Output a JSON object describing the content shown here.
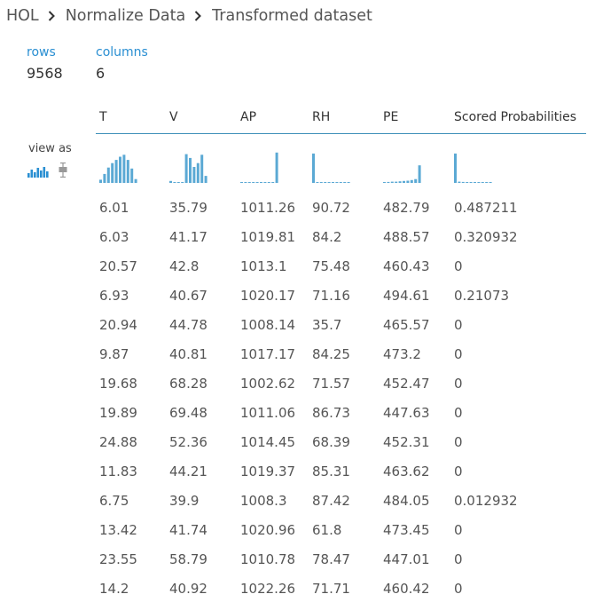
{
  "breadcrumb": {
    "items": [
      "HOL",
      "Normalize Data",
      "Transformed dataset"
    ],
    "separator_icon": "chevron-right-icon"
  },
  "summary": {
    "rows_label": "rows",
    "rows_value": "9568",
    "columns_label": "columns",
    "columns_value": "6"
  },
  "view_as": {
    "label": "view as",
    "options": [
      "histogram-icon",
      "boxplot-icon"
    ],
    "selected": "histogram-icon"
  },
  "colors": {
    "accent": "#2a8fd2",
    "histogram_bar": "#5ba9d4",
    "header_rule": "#3d8fb8",
    "text": "#555555"
  },
  "table": {
    "columns": [
      "T",
      "V",
      "AP",
      "RH",
      "PE",
      "Scored Probabilities"
    ],
    "histograms": [
      [
        0.1,
        0.28,
        0.48,
        0.62,
        0.72,
        0.82,
        0.88,
        0.72,
        0.45,
        0.12
      ],
      [
        0.06,
        0,
        0,
        0,
        0.9,
        0.78,
        0.5,
        0.62,
        0.88,
        0.22
      ],
      [
        0,
        0,
        0,
        0,
        0,
        0,
        0,
        0,
        0,
        0.95
      ],
      [
        0.92,
        0,
        0,
        0,
        0,
        0,
        0,
        0,
        0,
        0
      ],
      [
        0.02,
        0.03,
        0.04,
        0.04,
        0.05,
        0.06,
        0.07,
        0.09,
        0.12,
        0.55
      ],
      [
        0.92,
        0.04,
        0.03,
        0.02,
        0.02,
        0.02,
        0.02,
        0.02,
        0.02,
        0.02
      ]
    ],
    "rows": [
      [
        "6.01",
        "35.79",
        "1011.26",
        "90.72",
        "482.79",
        "0.487211"
      ],
      [
        "6.03",
        "41.17",
        "1019.81",
        "84.2",
        "488.57",
        "0.320932"
      ],
      [
        "20.57",
        "42.8",
        "1013.1",
        "75.48",
        "460.43",
        "0"
      ],
      [
        "6.93",
        "40.67",
        "1020.17",
        "71.16",
        "494.61",
        "0.21073"
      ],
      [
        "20.94",
        "44.78",
        "1008.14",
        "35.7",
        "465.57",
        "0"
      ],
      [
        "9.87",
        "40.81",
        "1017.17",
        "84.25",
        "473.2",
        "0"
      ],
      [
        "19.68",
        "68.28",
        "1002.62",
        "71.57",
        "452.47",
        "0"
      ],
      [
        "19.89",
        "69.48",
        "1011.06",
        "86.73",
        "447.63",
        "0"
      ],
      [
        "24.88",
        "52.36",
        "1014.45",
        "68.39",
        "452.31",
        "0"
      ],
      [
        "11.83",
        "44.21",
        "1019.37",
        "85.31",
        "463.62",
        "0"
      ],
      [
        "6.75",
        "39.9",
        "1008.3",
        "87.42",
        "484.05",
        "0.012932"
      ],
      [
        "13.42",
        "41.74",
        "1020.96",
        "61.8",
        "473.45",
        "0"
      ],
      [
        "23.55",
        "58.79",
        "1010.78",
        "78.47",
        "447.01",
        "0"
      ],
      [
        "14.2",
        "40.92",
        "1022.26",
        "71.71",
        "460.42",
        "0"
      ]
    ]
  }
}
